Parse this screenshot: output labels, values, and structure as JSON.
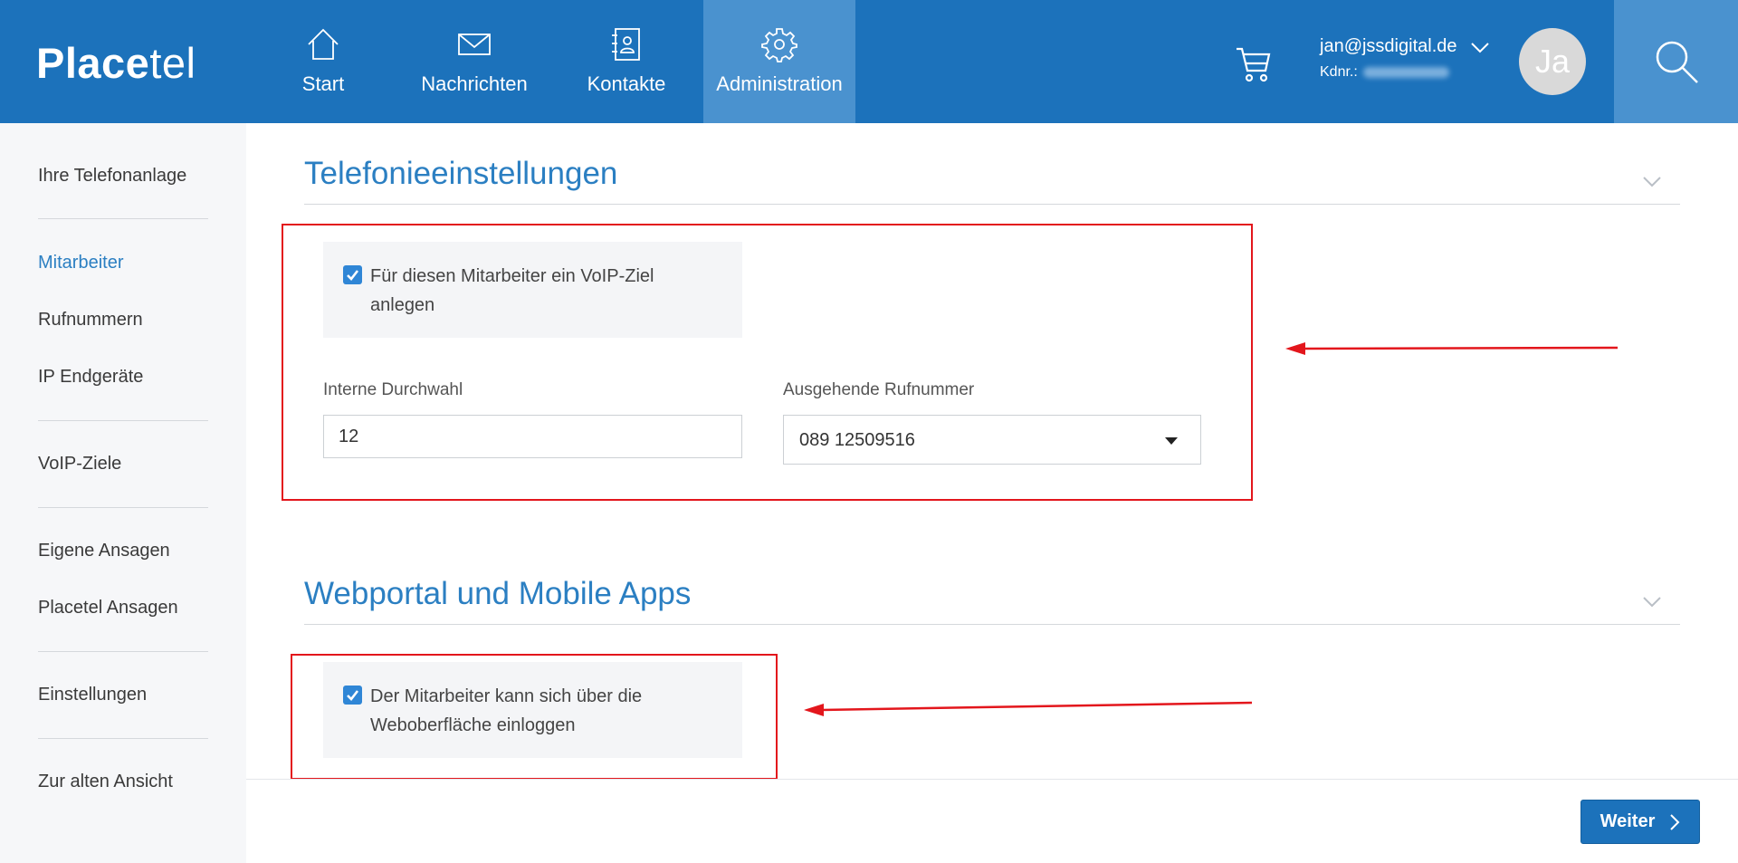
{
  "app": {
    "logo_bold": "Place",
    "logo_light": "tel"
  },
  "nav": {
    "items": [
      {
        "label": "Start",
        "icon": "home-icon"
      },
      {
        "label": "Nachrichten",
        "icon": "envelope-icon"
      },
      {
        "label": "Kontakte",
        "icon": "contact-book-icon"
      },
      {
        "label": "Administration",
        "icon": "gear-icon",
        "active": true
      }
    ]
  },
  "account": {
    "email": "jan@jssdigital.de",
    "kdnr_label": "Kdnr.:",
    "avatar_initials": "Ja"
  },
  "sidebar": {
    "items": [
      {
        "label": "Ihre Telefonanlage"
      },
      {
        "label": "Mitarbeiter",
        "active": true
      },
      {
        "label": "Rufnummern"
      },
      {
        "label": "IP Endgeräte"
      },
      {
        "label": "VoIP-Ziele"
      },
      {
        "label": "Eigene Ansagen"
      },
      {
        "label": "Placetel Ansagen"
      },
      {
        "label": "Einstellungen"
      },
      {
        "label": "Zur alten Ansicht"
      }
    ]
  },
  "telefonie": {
    "title": "Telefonieeinstellungen",
    "voip_checkbox_label": "Für diesen Mitarbeiter ein VoIP-Ziel anlegen",
    "voip_checked": true,
    "durchwahl_label": "Interne Durchwahl",
    "durchwahl_value": "12",
    "rufnummer_label": "Ausgehende Rufnummer",
    "rufnummer_value": "089 12509516"
  },
  "webportal": {
    "title": "Webportal und Mobile Apps",
    "login_checkbox_label": "Der Mitarbeiter kann sich über die Weboberfläche einloggen",
    "login_checked": true
  },
  "footer": {
    "weiter_label": "Weiter"
  },
  "colors": {
    "header": "#1c72bb",
    "active_nav": "#4a92cf",
    "accent": "#2b7fc2",
    "annotation": "#e3161c"
  }
}
